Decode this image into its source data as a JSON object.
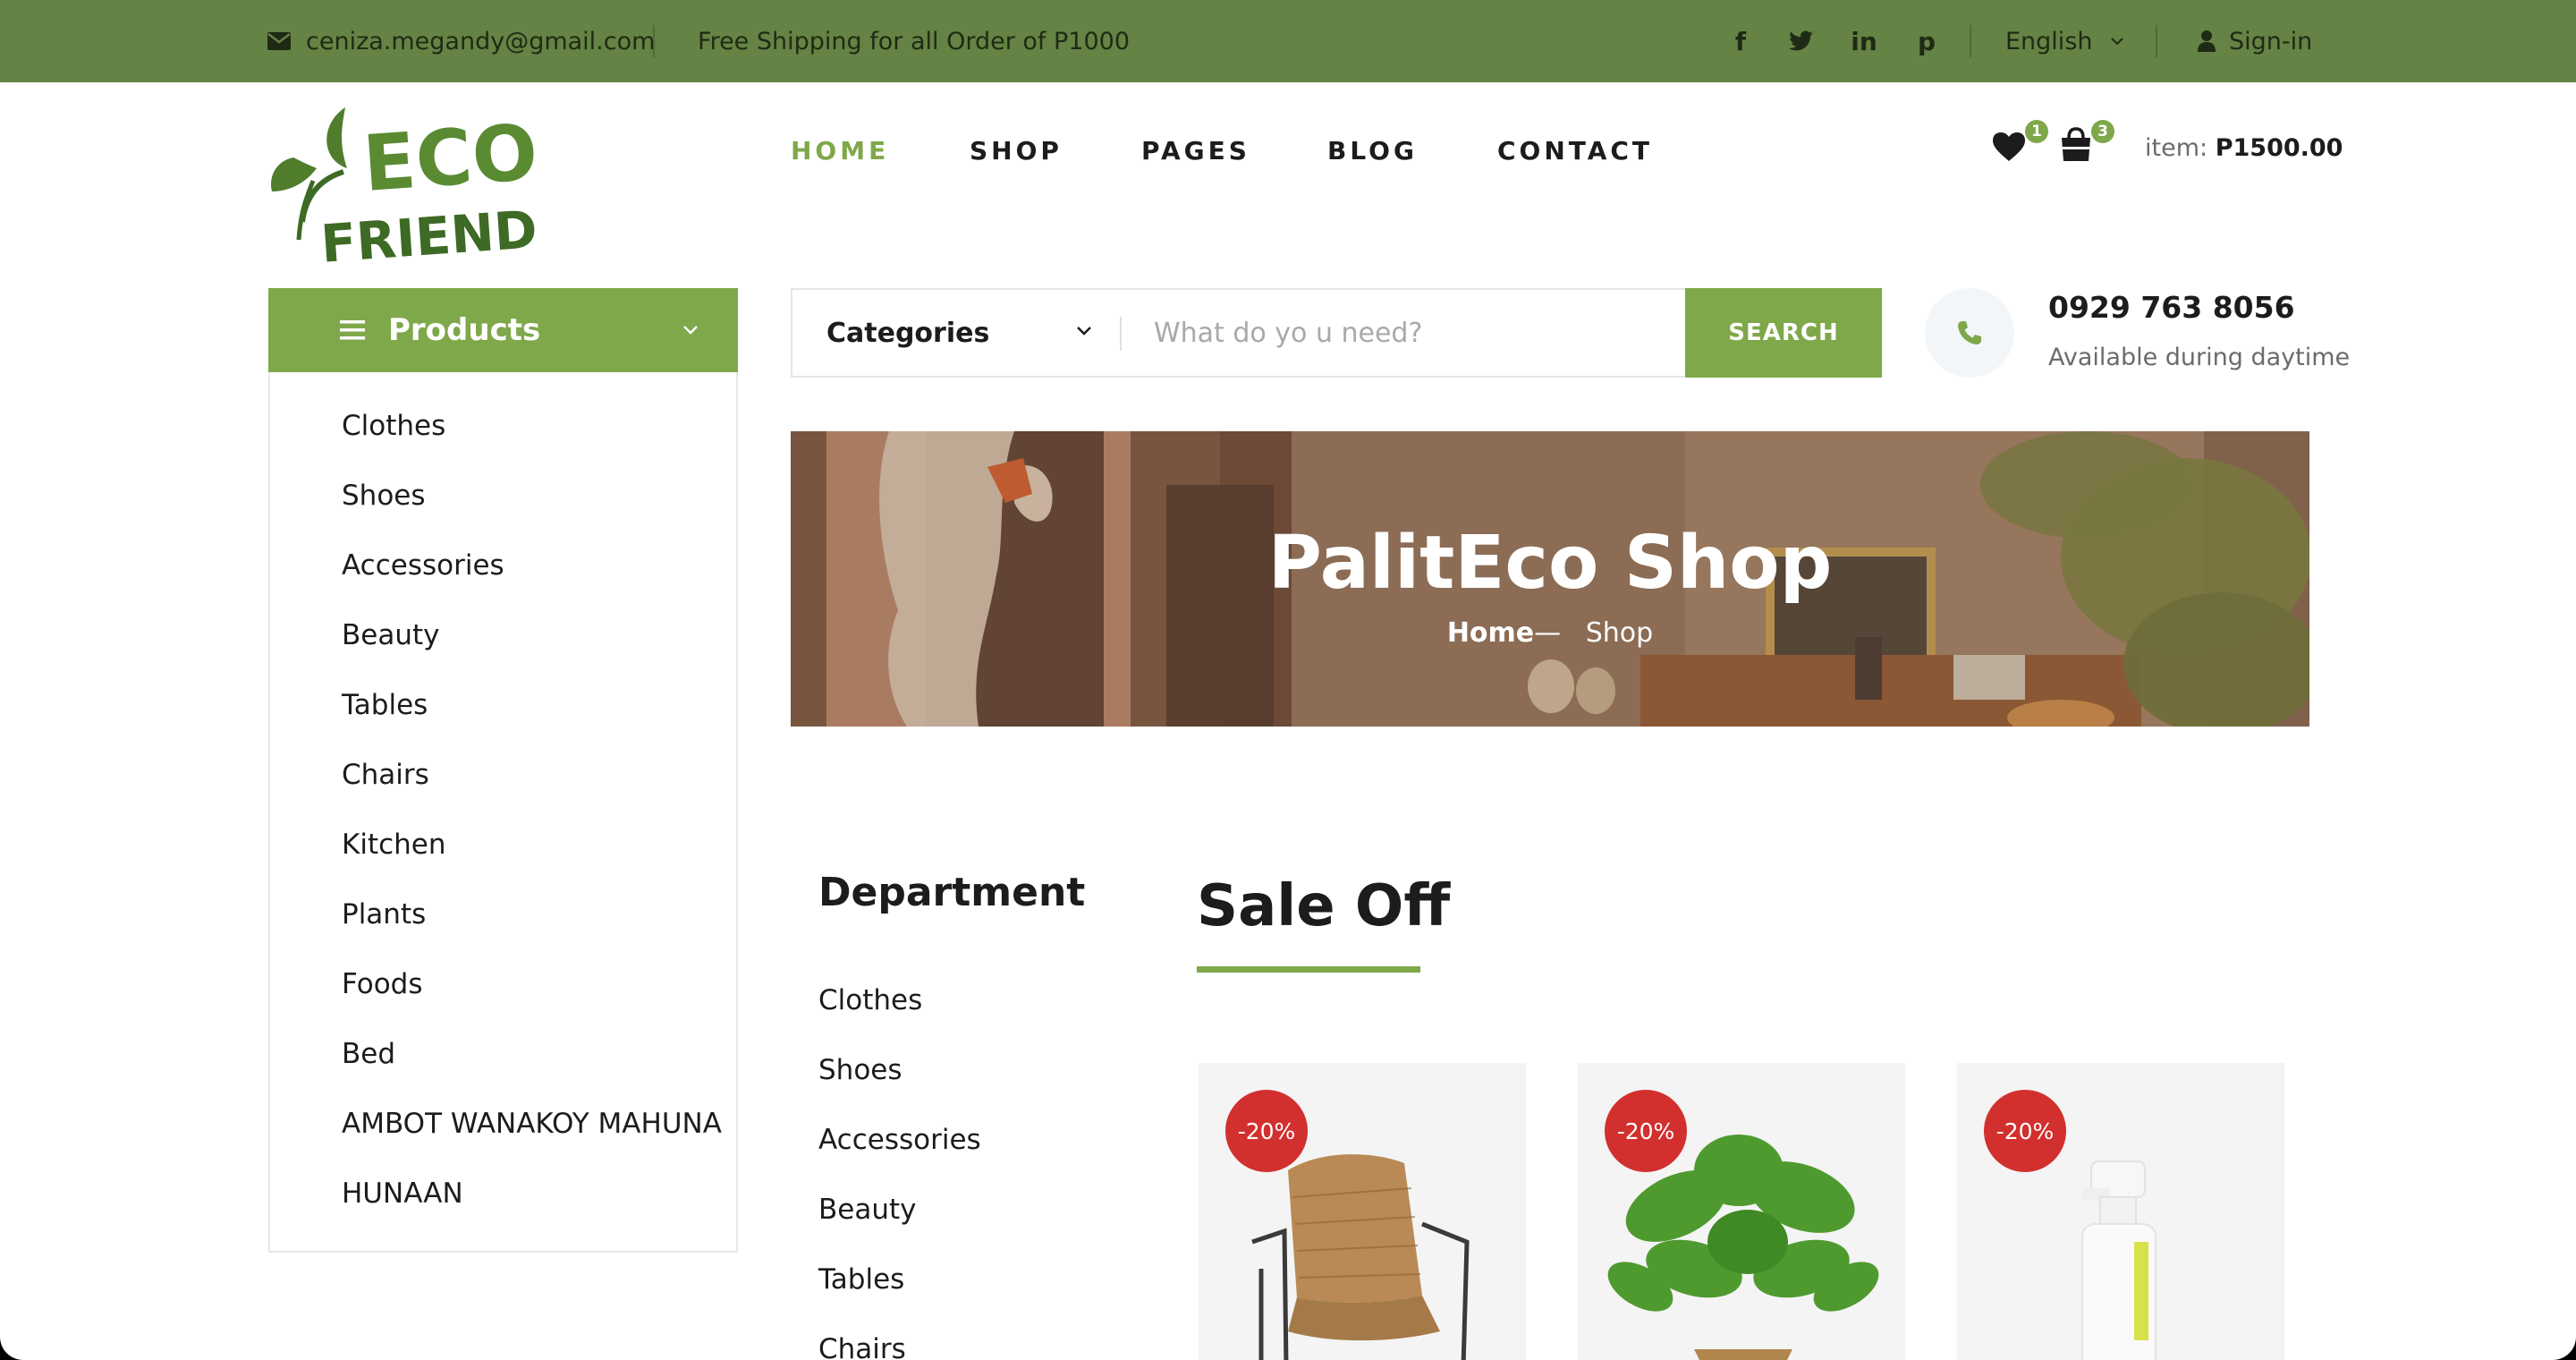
{
  "topbar": {
    "email": "ceniza.megandy@gmail.com",
    "shipping_note": "Free Shipping for all Order of P1000",
    "social": [
      {
        "icon": "facebook-icon",
        "glyph": "f"
      },
      {
        "icon": "twitter-icon",
        "glyph": "t"
      },
      {
        "icon": "linkedin-icon",
        "glyph": "in"
      },
      {
        "icon": "pinterest-icon",
        "glyph": "p"
      }
    ],
    "language": "English",
    "signin": "Sign-in"
  },
  "header": {
    "logo_text_line1": "ECO",
    "logo_text_line2": "FRIENDLY",
    "nav": [
      "HOME",
      "SHOP",
      "PAGES",
      "BLOG",
      "CONTACT"
    ],
    "active_nav": "HOME",
    "wishlist_count": "1",
    "cart_count": "3",
    "cart_label": "item:",
    "cart_total": "P1500.00"
  },
  "sidebar": {
    "title": "Products",
    "items": [
      "Clothes",
      "Shoes",
      "Accessories",
      "Beauty",
      "Tables",
      "Chairs",
      "Kitchen",
      "Plants",
      "Foods",
      "Bed",
      "AMBOT WANAKOY MAHUNA",
      "HUNAAN"
    ]
  },
  "search": {
    "category_label": "Categories",
    "placeholder": "What do yo u need?",
    "button": "SEARCH"
  },
  "contact": {
    "phone": "0929 763 8056",
    "availability": "Available during daytime"
  },
  "hero": {
    "title": "PalitEco Shop",
    "crumb_home": "Home",
    "crumb_sep": "—",
    "crumb_current": "Shop"
  },
  "department": {
    "title": "Department",
    "items": [
      "Clothes",
      "Shoes",
      "Accessories",
      "Beauty",
      "Tables",
      "Chairs"
    ]
  },
  "sale": {
    "title": "Sale Off",
    "products": [
      {
        "discount": "-20%",
        "image": "rattan-chair"
      },
      {
        "discount": "-20%",
        "image": "potted-plant"
      },
      {
        "discount": "-20%",
        "image": "spray-bottle"
      }
    ]
  },
  "colors": {
    "topbar": "#648344",
    "accent": "#7fa84a",
    "discount": "#d2302e"
  }
}
